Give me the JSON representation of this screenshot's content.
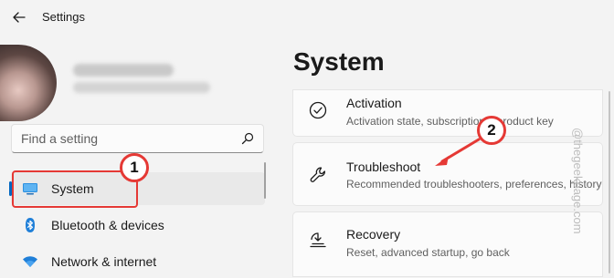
{
  "window": {
    "title": "Settings"
  },
  "search": {
    "placeholder": "Find a setting"
  },
  "nav": {
    "items": [
      {
        "label": "System",
        "selected": true,
        "icon": "system-monitor-icon"
      },
      {
        "label": "Bluetooth & devices",
        "selected": false,
        "icon": "bluetooth-icon"
      },
      {
        "label": "Network & internet",
        "selected": false,
        "icon": "wifi-icon"
      }
    ]
  },
  "page": {
    "title": "System"
  },
  "cards": [
    {
      "title": "Activation",
      "desc": "Activation state, subscriptions, product key",
      "icon": "check-circle-icon"
    },
    {
      "title": "Troubleshoot",
      "desc": "Recommended troubleshooters, preferences, history",
      "icon": "wrench-icon"
    },
    {
      "title": "Recovery",
      "desc": "Reset, advanced startup, go back",
      "icon": "recovery-icon"
    }
  ],
  "annotations": {
    "step1": "1",
    "step2": "2"
  },
  "watermark": "@thegeekpage.com",
  "colors": {
    "accent": "#0067c0",
    "annotation": "#e53935"
  }
}
